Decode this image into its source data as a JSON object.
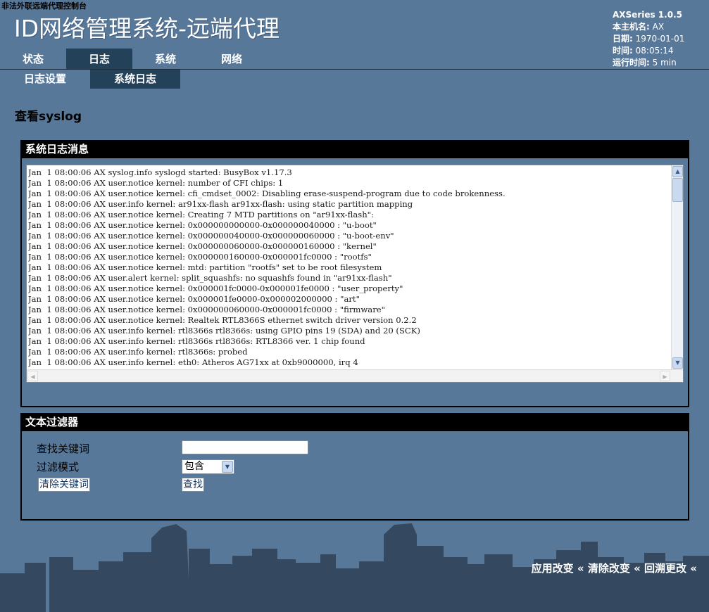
{
  "top_note": "非法外联远端代理控制台",
  "app_title": "ID网络管理系统-远端代理",
  "info": {
    "version": "AXSeries 1.0.5",
    "hostname_label": "本主机名:",
    "hostname": "AX",
    "date_label": "日期:",
    "date": "1970-01-01",
    "time_label": "时间:",
    "time": "08:05:14",
    "uptime_label": "运行时间:",
    "uptime": "5 min"
  },
  "nav": {
    "main": [
      "状态",
      "日志",
      "系统",
      "网络"
    ],
    "main_active": 1,
    "sub": [
      "日志设置",
      "系统日志"
    ],
    "sub_active": 1
  },
  "page_title": "查看syslog",
  "log_section": {
    "title": "系统日志消息",
    "lines": [
      "Jan  1 08:00:06 AX syslog.info syslogd started: BusyBox v1.17.3",
      "Jan  1 08:00:06 AX user.notice kernel: number of CFI chips: 1",
      "Jan  1 08:00:06 AX user.notice kernel: cfi_cmdset_0002: Disabling erase-suspend-program due to code brokenness.",
      "Jan  1 08:00:06 AX user.info kernel: ar91xx-flash ar91xx-flash: using static partition mapping",
      "Jan  1 08:00:06 AX user.notice kernel: Creating 7 MTD partitions on \"ar91xx-flash\":",
      "Jan  1 08:00:06 AX user.notice kernel: 0x000000000000-0x000000040000 : \"u-boot\"",
      "Jan  1 08:00:06 AX user.notice kernel: 0x000000040000-0x000000060000 : \"u-boot-env\"",
      "Jan  1 08:00:06 AX user.notice kernel: 0x000000060000-0x000000160000 : \"kernel\"",
      "Jan  1 08:00:06 AX user.notice kernel: 0x000000160000-0x000001fc0000 : \"rootfs\"",
      "Jan  1 08:00:06 AX user.notice kernel: mtd: partition \"rootfs\" set to be root filesystem",
      "Jan  1 08:00:06 AX user.alert kernel: split_squashfs: no squashfs found in \"ar91xx-flash\"",
      "Jan  1 08:00:06 AX user.notice kernel: 0x000001fc0000-0x000001fe0000 : \"user_property\"",
      "Jan  1 08:00:06 AX user.notice kernel: 0x000001fe0000-0x000002000000 : \"art\"",
      "Jan  1 08:00:06 AX user.notice kernel: 0x000000060000-0x000001fc0000 : \"firmware\"",
      "Jan  1 08:00:06 AX user.notice kernel: Realtek RTL8366S ethernet switch driver version 0.2.2",
      "Jan  1 08:00:06 AX user.info kernel: rtl8366s rtl8366s: using GPIO pins 19 (SDA) and 20 (SCK)",
      "Jan  1 08:00:06 AX user.info kernel: rtl8366s rtl8366s: RTL8366 ver. 1 chip found",
      "Jan  1 08:00:06 AX user.info kernel: rtl8366s: probed",
      "Jan  1 08:00:06 AX user.info kernel: eth0: Atheros AG71xx at 0xb9000000, irq 4"
    ]
  },
  "filter_section": {
    "title": "文本过滤器",
    "keyword_label": "查找关键词",
    "keyword_value": "",
    "mode_label": "过滤模式",
    "mode_value": "包含",
    "clear_button": "清除关键词",
    "search_button": "查找"
  },
  "footer": {
    "apply": "应用改变",
    "clear": "清除改变",
    "revert": "回溯更改",
    "separator": "«"
  },
  "colors": {
    "background": "#58789a",
    "active_tab": "#234159",
    "section_header": "#000000",
    "skyline": "#34495f"
  }
}
